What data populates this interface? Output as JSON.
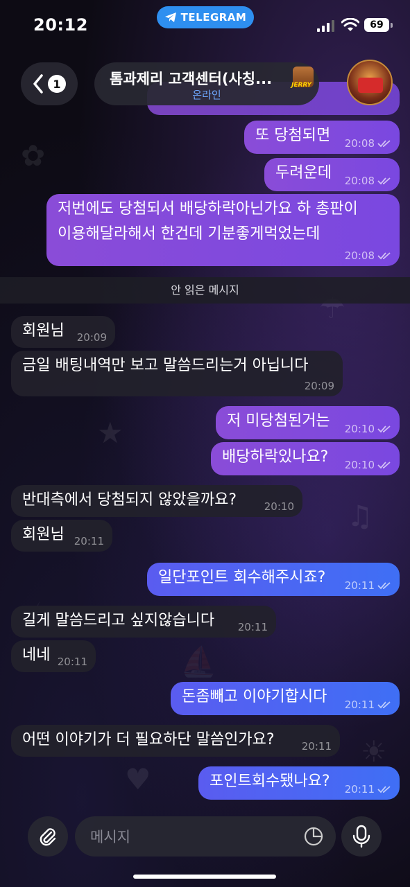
{
  "status_bar": {
    "time": "20:12",
    "banner": "TELEGRAM",
    "battery": "69"
  },
  "header": {
    "unread_count": "1",
    "title": "톰과제리 고객센터(사칭...",
    "status": "온라인",
    "logo_text": "JERRY"
  },
  "messages": [
    {
      "dir": "out",
      "text": "또 당첨되면",
      "time": "20:08"
    },
    {
      "dir": "out",
      "text": "두려운데",
      "time": "20:08"
    },
    {
      "dir": "out",
      "line1": "저번에도 당첨되서 배당하락아닌가요 하 총판이",
      "line2": "이용해달라해서 한건데  기분좋게먹었는데",
      "time": "20:08"
    },
    {
      "dir": "in",
      "text": "회원님",
      "time": "20:09"
    },
    {
      "dir": "in",
      "text": "금일 배팅내역만 보고 말씀드리는거 아닙니다",
      "time": "20:09"
    },
    {
      "dir": "out",
      "text": "저 미당첨된거는",
      "time": "20:10"
    },
    {
      "dir": "out",
      "text": "배당하락있나요?",
      "time": "20:10"
    },
    {
      "dir": "in",
      "text": "반대측에서 당첨되지 않았을까요?",
      "time": "20:10"
    },
    {
      "dir": "in",
      "text": "회원님",
      "time": "20:11"
    },
    {
      "dir": "out",
      "text": "일단포인트 회수해주시죠?",
      "time": "20:11"
    },
    {
      "dir": "in",
      "text": "길게 말씀드리고 싶지않습니다",
      "time": "20:11"
    },
    {
      "dir": "in",
      "text": "네네",
      "time": "20:11"
    },
    {
      "dir": "out",
      "text": "돈좀빼고 이야기합시다",
      "time": "20:11"
    },
    {
      "dir": "in",
      "text": "어떤 이야기가 더 필요하단 말씀인가요?",
      "time": "20:11"
    },
    {
      "dir": "out",
      "text": "포인트회수됐나요?",
      "time": "20:11"
    }
  ],
  "unread_divider": "안 읽은 메시지",
  "composer": {
    "placeholder": "메시지"
  },
  "colors": {
    "outgoing_top": "#8a4cd8",
    "outgoing_bottom": "#3f6ff5",
    "incoming": "#22212c",
    "accent": "#2e8ff0"
  }
}
